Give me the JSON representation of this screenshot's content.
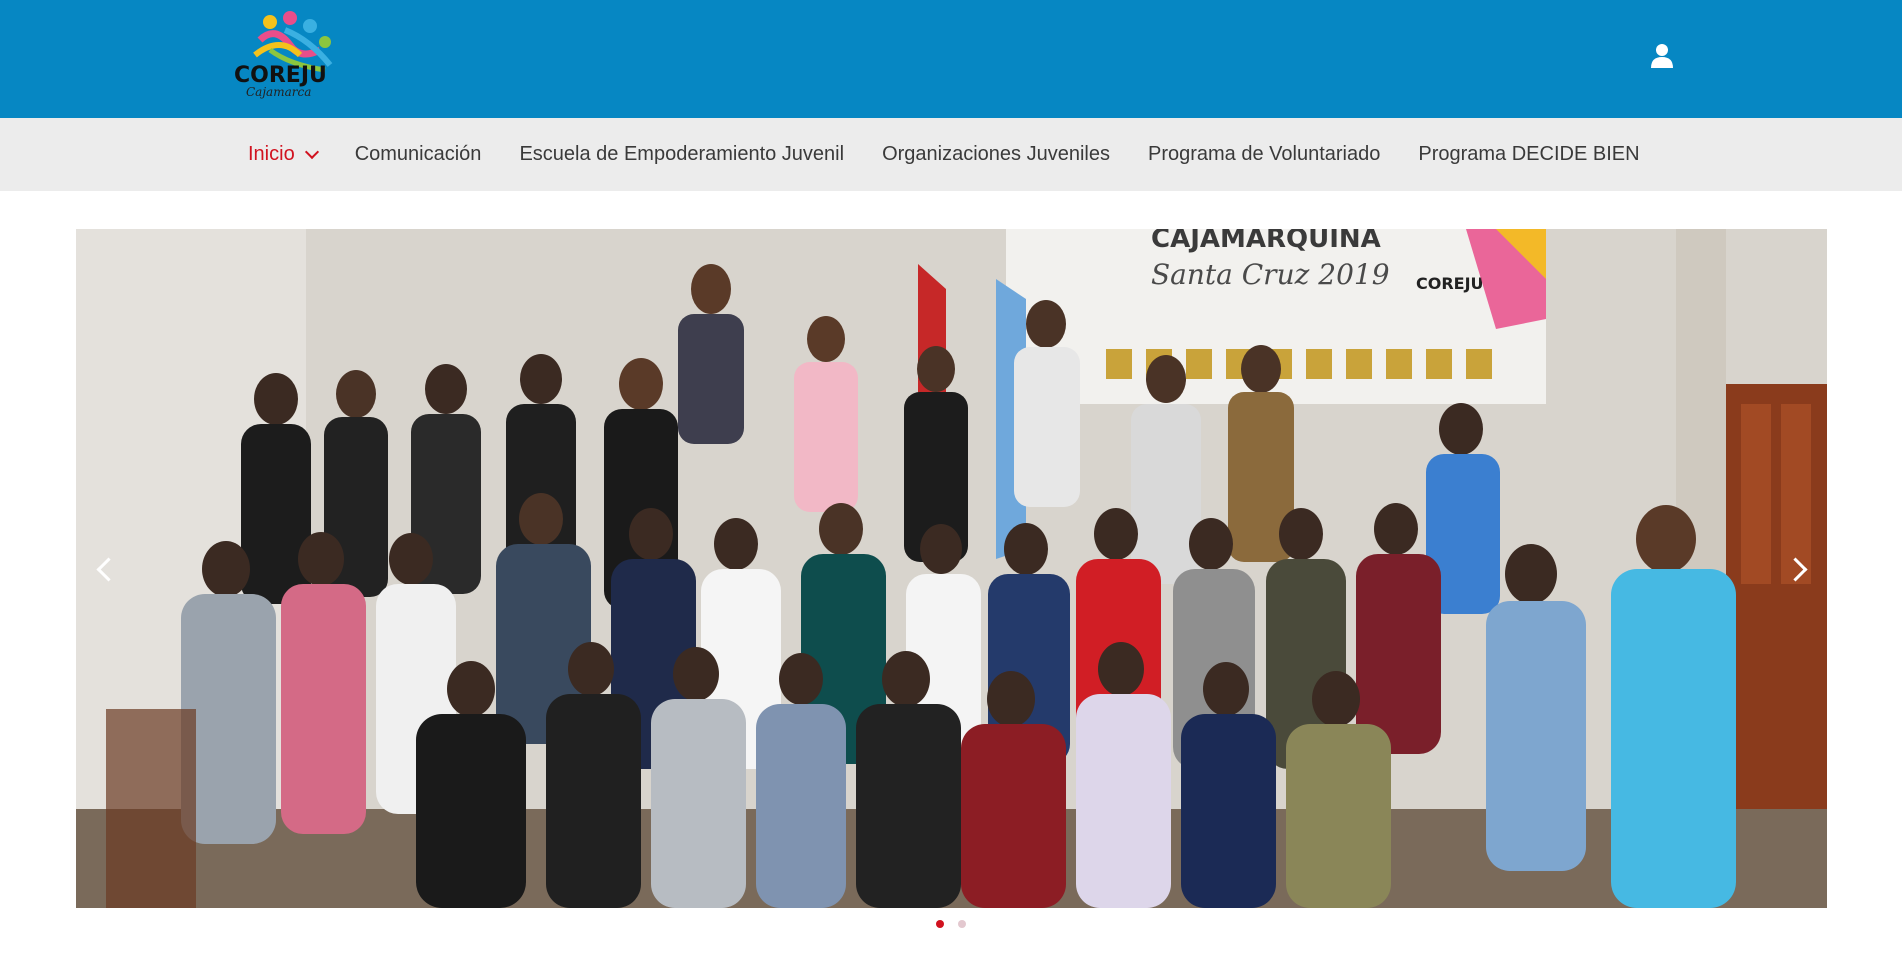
{
  "brand": {
    "logo_text": "COREJU",
    "logo_subtext": "Cajamarca"
  },
  "header": {
    "user_icon": "user-icon",
    "background_color": "#0687c3"
  },
  "nav": {
    "items": [
      {
        "label": "Inicio",
        "active": true,
        "has_dropdown": true
      },
      {
        "label": "Comunicación",
        "active": false
      },
      {
        "label": "Escuela de Empoderamiento Juvenil",
        "active": false
      },
      {
        "label": "Organizaciones Juveniles",
        "active": false
      },
      {
        "label": "Programa de Voluntariado",
        "active": false
      },
      {
        "label": "Programa DECIDE BIEN",
        "active": false
      }
    ],
    "active_color": "#d1121f"
  },
  "slider": {
    "banner_line1": "CAJAMARQUINA",
    "banner_line2": "Santa Cruz 2019",
    "banner_logo": "COREJU",
    "prev_icon": "chevron-left-icon",
    "next_icon": "chevron-right-icon",
    "current_slide": 1,
    "total_slides": 2
  }
}
